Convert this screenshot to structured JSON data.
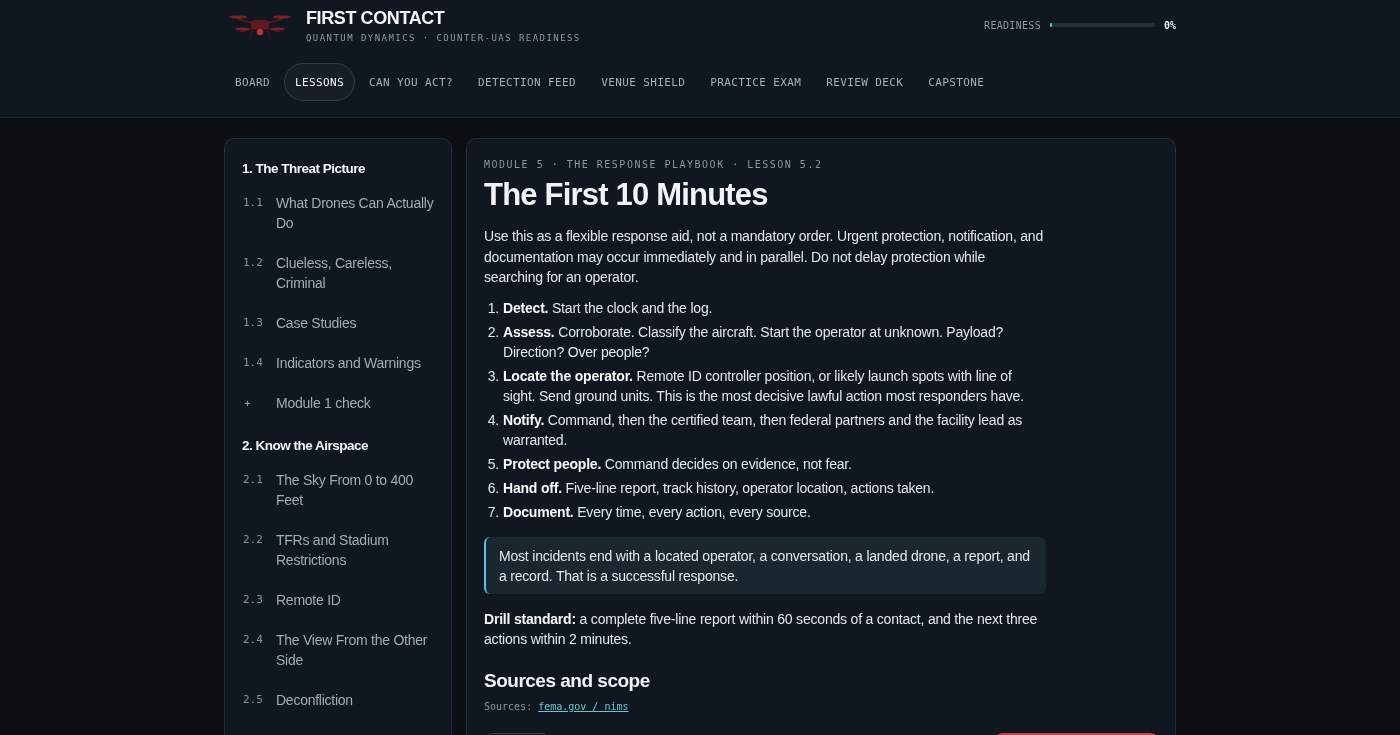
{
  "header": {
    "title": "FIRST CONTACT",
    "subtitle": "QUANTUM DYNAMICS · COUNTER-UAS READINESS",
    "readiness": {
      "label": "READINESS",
      "level": 0,
      "reading": "0%"
    }
  },
  "tabs": [
    {
      "label": "BOARD",
      "selected": false
    },
    {
      "label": "LESSONS",
      "selected": true
    },
    {
      "label": "CAN YOU ACT?",
      "selected": false
    },
    {
      "label": "DETECTION FEED",
      "selected": false
    },
    {
      "label": "VENUE SHIELD",
      "selected": false
    },
    {
      "label": "PRACTICE EXAM",
      "selected": false
    },
    {
      "label": "REVIEW DECK",
      "selected": false
    },
    {
      "label": "CAPSTONE",
      "selected": false
    }
  ],
  "sidebar": {
    "modules": [
      {
        "title": "1. The Threat Picture",
        "items": [
          {
            "kind": "lesson",
            "number": "1.1",
            "title": "What Drones Can Actually Do"
          },
          {
            "kind": "lesson",
            "number": "1.2",
            "title": "Clueless, Careless, Criminal"
          },
          {
            "kind": "lesson",
            "number": "1.3",
            "title": "Case Studies"
          },
          {
            "kind": "lesson",
            "number": "1.4",
            "title": "Indicators and Warnings"
          },
          {
            "kind": "check",
            "title": "Module 1 check"
          }
        ]
      },
      {
        "title": "2. Know the Airspace",
        "items": [
          {
            "kind": "lesson",
            "number": "2.1",
            "title": "The Sky From 0 to 400 Feet"
          },
          {
            "kind": "lesson",
            "number": "2.2",
            "title": "TFRs and Stadium Restrictions"
          },
          {
            "kind": "lesson",
            "number": "2.3",
            "title": "Remote ID"
          },
          {
            "kind": "lesson",
            "number": "2.4",
            "title": "The View From the Other Side"
          },
          {
            "kind": "lesson",
            "number": "2.5",
            "title": "Deconfliction"
          }
        ]
      }
    ]
  },
  "lesson": {
    "breadcrumb": "MODULE 5 · THE RESPONSE PLAYBOOK · LESSON 5.2",
    "title": "The First 10 Minutes",
    "intro": "Use this as a flexible response aid, not a mandatory order. Urgent protection, notification, and documentation may occur immediately and in parallel. Do not delay protection while searching for an operator.",
    "steps": [
      {
        "number": "1.",
        "text": "**Detect.** Start the clock and the log."
      },
      {
        "number": "2.",
        "text": "**Assess.** Corroborate. Classify the aircraft. Start the operator at unknown. Payload? Direction? Over people?"
      },
      {
        "number": "3.",
        "text": "**Locate the operator.** Remote ID controller position, or likely launch spots with line of sight. Send ground units. This is the most decisive lawful action most responders have."
      },
      {
        "number": "4.",
        "text": "**Notify.** Command, then the certified team, then federal partners and the facility lead as warranted."
      },
      {
        "number": "5.",
        "text": "**Protect people.** Command decides on evidence, not fear."
      },
      {
        "number": "6.",
        "text": "**Hand off.** Five-line report, track history, operator location, actions taken."
      },
      {
        "number": "7.",
        "text": "**Document.** Every time, every action, every source."
      }
    ],
    "callout": "Most incidents end with a located operator, a conversation, a landed drone, a report, and a record. That is a successful response.",
    "drill": "**Drill standard:** a complete five-line report within 60 seconds of a contact, and the next three actions within 2 minutes.",
    "sources_heading": "Sources and scope",
    "sources_label": "Sources:",
    "sources_link": "fema.gov / nims",
    "buttons": [
      {
        "kind": "secondary"
      },
      {
        "kind": "primary"
      }
    ]
  }
}
